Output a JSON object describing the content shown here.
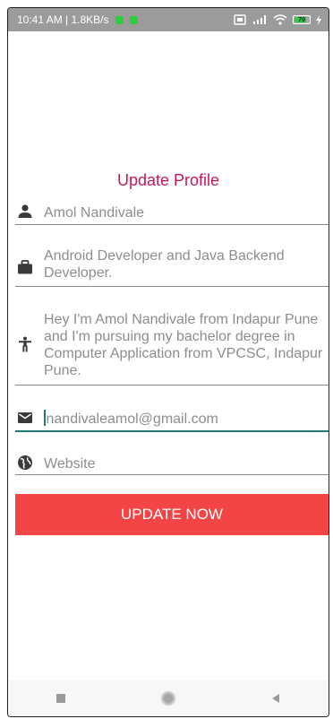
{
  "status_bar": {
    "time_speed": "10:41 AM | 1.8KB/s",
    "battery": "70"
  },
  "page": {
    "title": "Update Profile"
  },
  "form": {
    "name": "Amol Nandivale",
    "profession": "Android Developer and Java Backend Developer.",
    "bio": "Hey I'm Amol Nandivale from Indapur Pune and I'm pursuing my bachelor degree in Computer Application from VPCSC, Indapur Pune.",
    "email": "nandivaleamol@gmail.com",
    "website_placeholder": "Website"
  },
  "button": {
    "label": "UPDATE NOW"
  },
  "icons": {
    "name": "person-icon",
    "profession": "briefcase-icon",
    "bio": "accessibility-icon",
    "email": "mail-icon",
    "website": "globe-icon"
  },
  "colors": {
    "accent": "#c2185b",
    "button": "#f44546",
    "focus_underline": "#1f7a76"
  }
}
